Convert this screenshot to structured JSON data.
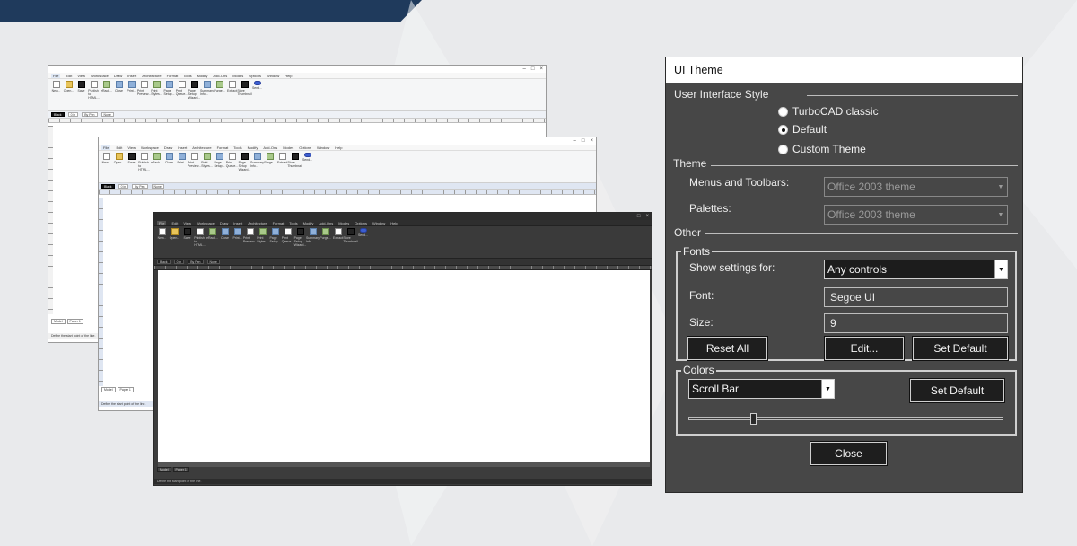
{
  "dialog": {
    "title": "UI Theme",
    "ui_style": {
      "label": "User Interface Style",
      "options": [
        {
          "label": "TurboCAD classic",
          "checked": false
        },
        {
          "label": "Default",
          "checked": true
        },
        {
          "label": "Custom Theme",
          "checked": false
        }
      ]
    },
    "theme": {
      "label": "Theme",
      "menus_label": "Menus and Toolbars:",
      "menus_value": "Office 2003 theme",
      "palettes_label": "Palettes:",
      "palettes_value": "Office 2003 theme"
    },
    "other": {
      "label": "Other"
    },
    "fonts": {
      "title": "Fonts",
      "show_for_label": "Show settings for:",
      "show_for_value": "Any controls",
      "font_label": "Font:",
      "font_value": "Segoe UI",
      "size_label": "Size:",
      "size_value": "9",
      "reset_all": "Reset All",
      "edit": "Edit...",
      "set_default": "Set Default"
    },
    "colors": {
      "title": "Colors",
      "element_value": "Scroll Bar",
      "set_default": "Set Default",
      "slider_level": 0.2
    },
    "close": "Close"
  },
  "cad": {
    "menu": [
      "File",
      "Edit",
      "View",
      "Workspace",
      "Draw",
      "Insert",
      "Architecture",
      "Format",
      "Tools",
      "Modify",
      "Add-Ons",
      "Modes",
      "Options",
      "Window",
      "Help"
    ],
    "ribbon": [
      "New...",
      "Open...",
      "Save",
      "Publish to HTML...",
      "eRack...",
      "Close",
      "Print...",
      "Print Preview...",
      "Print Styles...",
      "Page Setup...",
      "Print Queue...",
      "Page Setup Wizard...",
      "Summary Info...",
      "Purge...",
      "Extract",
      "Store Thumbnail",
      "Send..."
    ],
    "color_field": "Black",
    "length_field": "0 in",
    "layer_field": "By Pen",
    "none_field": "None",
    "tabs": [
      "Model",
      "Paper 1"
    ],
    "status": "Define the start point of the line."
  }
}
